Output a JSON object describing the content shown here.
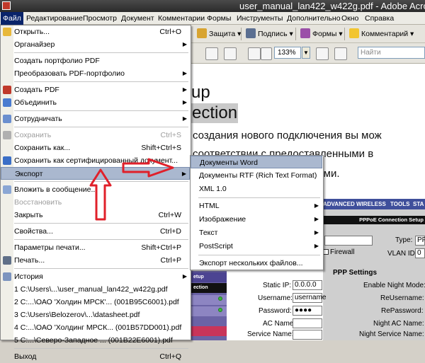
{
  "window": {
    "title": "user_manual_lan422_w422g.pdf - Adobe Acrob"
  },
  "menubar": [
    {
      "label": "Файл",
      "active": true
    },
    {
      "label": "Редактирование"
    },
    {
      "label": "Просмотр"
    },
    {
      "label": "Документ"
    },
    {
      "label": "Комментарии"
    },
    {
      "label": "Формы"
    },
    {
      "label": "Инструменты"
    },
    {
      "label": "Дополнительно"
    },
    {
      "label": "Окно"
    },
    {
      "label": "Справка"
    }
  ],
  "toolbar": {
    "protect_label": "Защита ▾",
    "sign_label": "Подпись ▾",
    "forms_label": "Формы ▾",
    "comments_label": "Комментарий ▾",
    "zoom_value": "133%",
    "find_placeholder": "Найти"
  },
  "file_menu": {
    "items": [
      {
        "label": "Открыть...",
        "shortcut": "Ctrl+O",
        "icon": "folder-icon"
      },
      {
        "label": "Органайзер",
        "submenu": true
      },
      {
        "separator": true
      },
      {
        "label": "Создать портфолио PDF"
      },
      {
        "label": "Преобразовать PDF-портфолио",
        "submenu": true
      },
      {
        "separator": true
      },
      {
        "label": "Создать PDF",
        "submenu": true,
        "icon": "create-pdf-icon"
      },
      {
        "label": "Объединить",
        "submenu": true,
        "icon": "combine-icon"
      },
      {
        "separator": true
      },
      {
        "label": "Сотрудничать",
        "submenu": true,
        "icon": "collaborate-icon"
      },
      {
        "separator": true
      },
      {
        "label": "Сохранить",
        "shortcut": "Ctrl+S",
        "icon": "save-icon",
        "disabled": true
      },
      {
        "label": "Сохранить как...",
        "shortcut": "Shift+Ctrl+S"
      },
      {
        "label": "Сохранить как сертифицированный документ...",
        "icon": "certify-icon"
      },
      {
        "label": "Экспорт",
        "submenu": true,
        "highlighted": true
      },
      {
        "separator": true
      },
      {
        "label": "Вложить в сообщение...",
        "icon": "attach-email-icon"
      },
      {
        "label": "Восстановить",
        "disabled": true
      },
      {
        "label": "Закрыть",
        "shortcut": "Ctrl+W"
      },
      {
        "separator": true
      },
      {
        "label": "Свойства...",
        "shortcut": "Ctrl+D"
      },
      {
        "separator": true
      },
      {
        "label": "Параметры печати...",
        "shortcut": "Shift+Ctrl+P"
      },
      {
        "label": "Печать...",
        "shortcut": "Ctrl+P",
        "icon": "print-icon"
      },
      {
        "separator": true
      },
      {
        "label": "История",
        "submenu": true,
        "icon": "history-icon"
      },
      {
        "label": "1 C:\\Users\\...\\user_manual_lan422_w422g.pdf"
      },
      {
        "label": "2 C:...\\ОАО 'Холдин МРСК'... (001B95C6001).pdf"
      },
      {
        "label": "3 C:\\Users\\Belozerov\\...\\datasheet.pdf"
      },
      {
        "label": "4 C:...\\ОАО 'Холдинг МРСК... (001B57DD001).pdf"
      },
      {
        "label": "5 C:...\\Северо-Западное ... (001B22E6001).pdf"
      },
      {
        "separator": true
      },
      {
        "label": "Выход",
        "shortcut": "Ctrl+Q"
      }
    ]
  },
  "export_submenu": {
    "items": [
      {
        "label": "Документы Word",
        "highlighted": true
      },
      {
        "label": "Документы RTF (Rich Text Format)"
      },
      {
        "label": "XML 1.0"
      },
      {
        "separator": true
      },
      {
        "label": "HTML",
        "submenu": true
      },
      {
        "label": "Изображение",
        "submenu": true
      },
      {
        "label": "Текст",
        "submenu": true
      },
      {
        "label": "PostScript",
        "submenu": true
      },
      {
        "separator": true
      },
      {
        "label": "Экспорт нескольких файлов..."
      }
    ]
  },
  "document": {
    "heading1": "up",
    "heading2": "ection",
    "para1": "создания нового подключения вы мож",
    "para2": "соответствии с предоставленными в",
    "para3": "рами.",
    "router": {
      "nav": [
        "ADVANCED",
        "WIRELESS",
        "TOOLS",
        "STA"
      ],
      "pppoe_title": "PPPoE Connection Setup",
      "type_label": "Type:",
      "type_value": "PP",
      "firewall_label": "Firewall",
      "vlan_label": "VLAN ID:",
      "vlan_value": "0",
      "ppp_settings": "PPP Settings",
      "static_ip_label": "Static IP:",
      "static_ip_value": "0.0.0.0",
      "username_label": "Username:",
      "username_value": "username",
      "password_label": "Password:",
      "password_value": "●●●●",
      "ac_name_label": "AC Name:",
      "service_name_label": "Service Name:",
      "night_mode_label": "Enable Night Mode:",
      "reusername_label": "ReUsername:",
      "repassword_label": "RePassword:",
      "night_ac_label": "Night AC Name:",
      "night_service_label": "Night Service Name:",
      "side_rows": [
        "etup",
        "ection"
      ]
    }
  },
  "colors": {
    "menu_highlight": "#aab8cf",
    "menubar_active": "#0a246a",
    "annotation_arrow": "#e0202a",
    "router_nav": "#3f4f9b",
    "router_side": "#6b63a6"
  }
}
